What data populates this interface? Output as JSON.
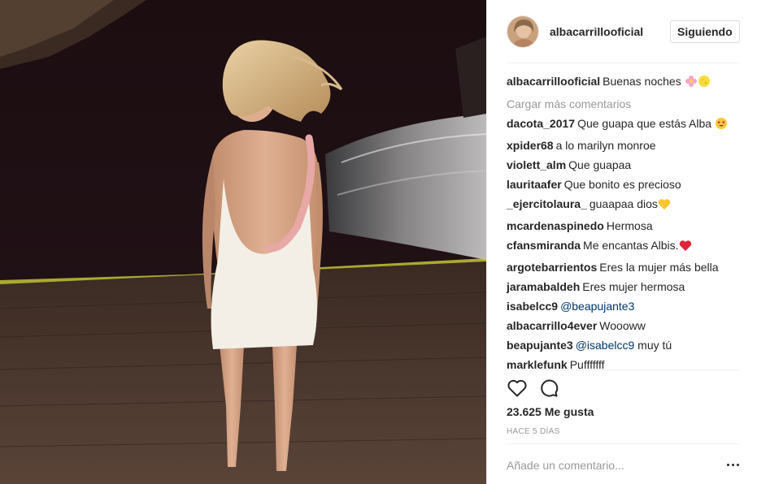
{
  "post": {
    "username": "albacarrillooficial",
    "follow_label": "Siguiendo",
    "caption": {
      "user": "albacarrillooficial",
      "text": "Buenas noches"
    },
    "load_more": "Cargar más comentarios",
    "comments": [
      {
        "user": "dacota_2017",
        "text": "Que guapa que estás Alba",
        "emoji": "heart-eyes"
      },
      {
        "user": "xpider68",
        "text": "a lo marilyn monroe"
      },
      {
        "user": "violett_alm",
        "text": "Que guapaa"
      },
      {
        "user": "lauritaafer",
        "text": "Que bonito es precioso"
      },
      {
        "user": "_ejercitolaura_",
        "text": "guaapaa dios",
        "emoji": "yellow-heart"
      },
      {
        "user": "mcardenaspinedo",
        "text": "Hermosa"
      },
      {
        "user": "cfansmiranda",
        "text": "Me encantas Albis.",
        "emoji": "red-heart"
      },
      {
        "user": "argotebarrientos",
        "text": "Eres la mujer más bella"
      },
      {
        "user": "jaramabaldeh",
        "text": "Eres mujer hermosa"
      },
      {
        "user": "isabelcc9",
        "mention": "@beapujante3"
      },
      {
        "user": "albacarrillo4ever",
        "text": "Woooww"
      },
      {
        "user": "beapujante3",
        "mention": "@isabelcc9",
        "text": "muy tú"
      },
      {
        "user": "marklefunk",
        "text": "Pufffffff"
      }
    ],
    "likes": "23.625 Me gusta",
    "time": "HACE 5 DÍAS",
    "comment_placeholder": "Añade un comentario...",
    "icons": {
      "like": "heart-outline-icon",
      "comment": "comment-bubble-icon",
      "more": "more-options-icon"
    }
  }
}
